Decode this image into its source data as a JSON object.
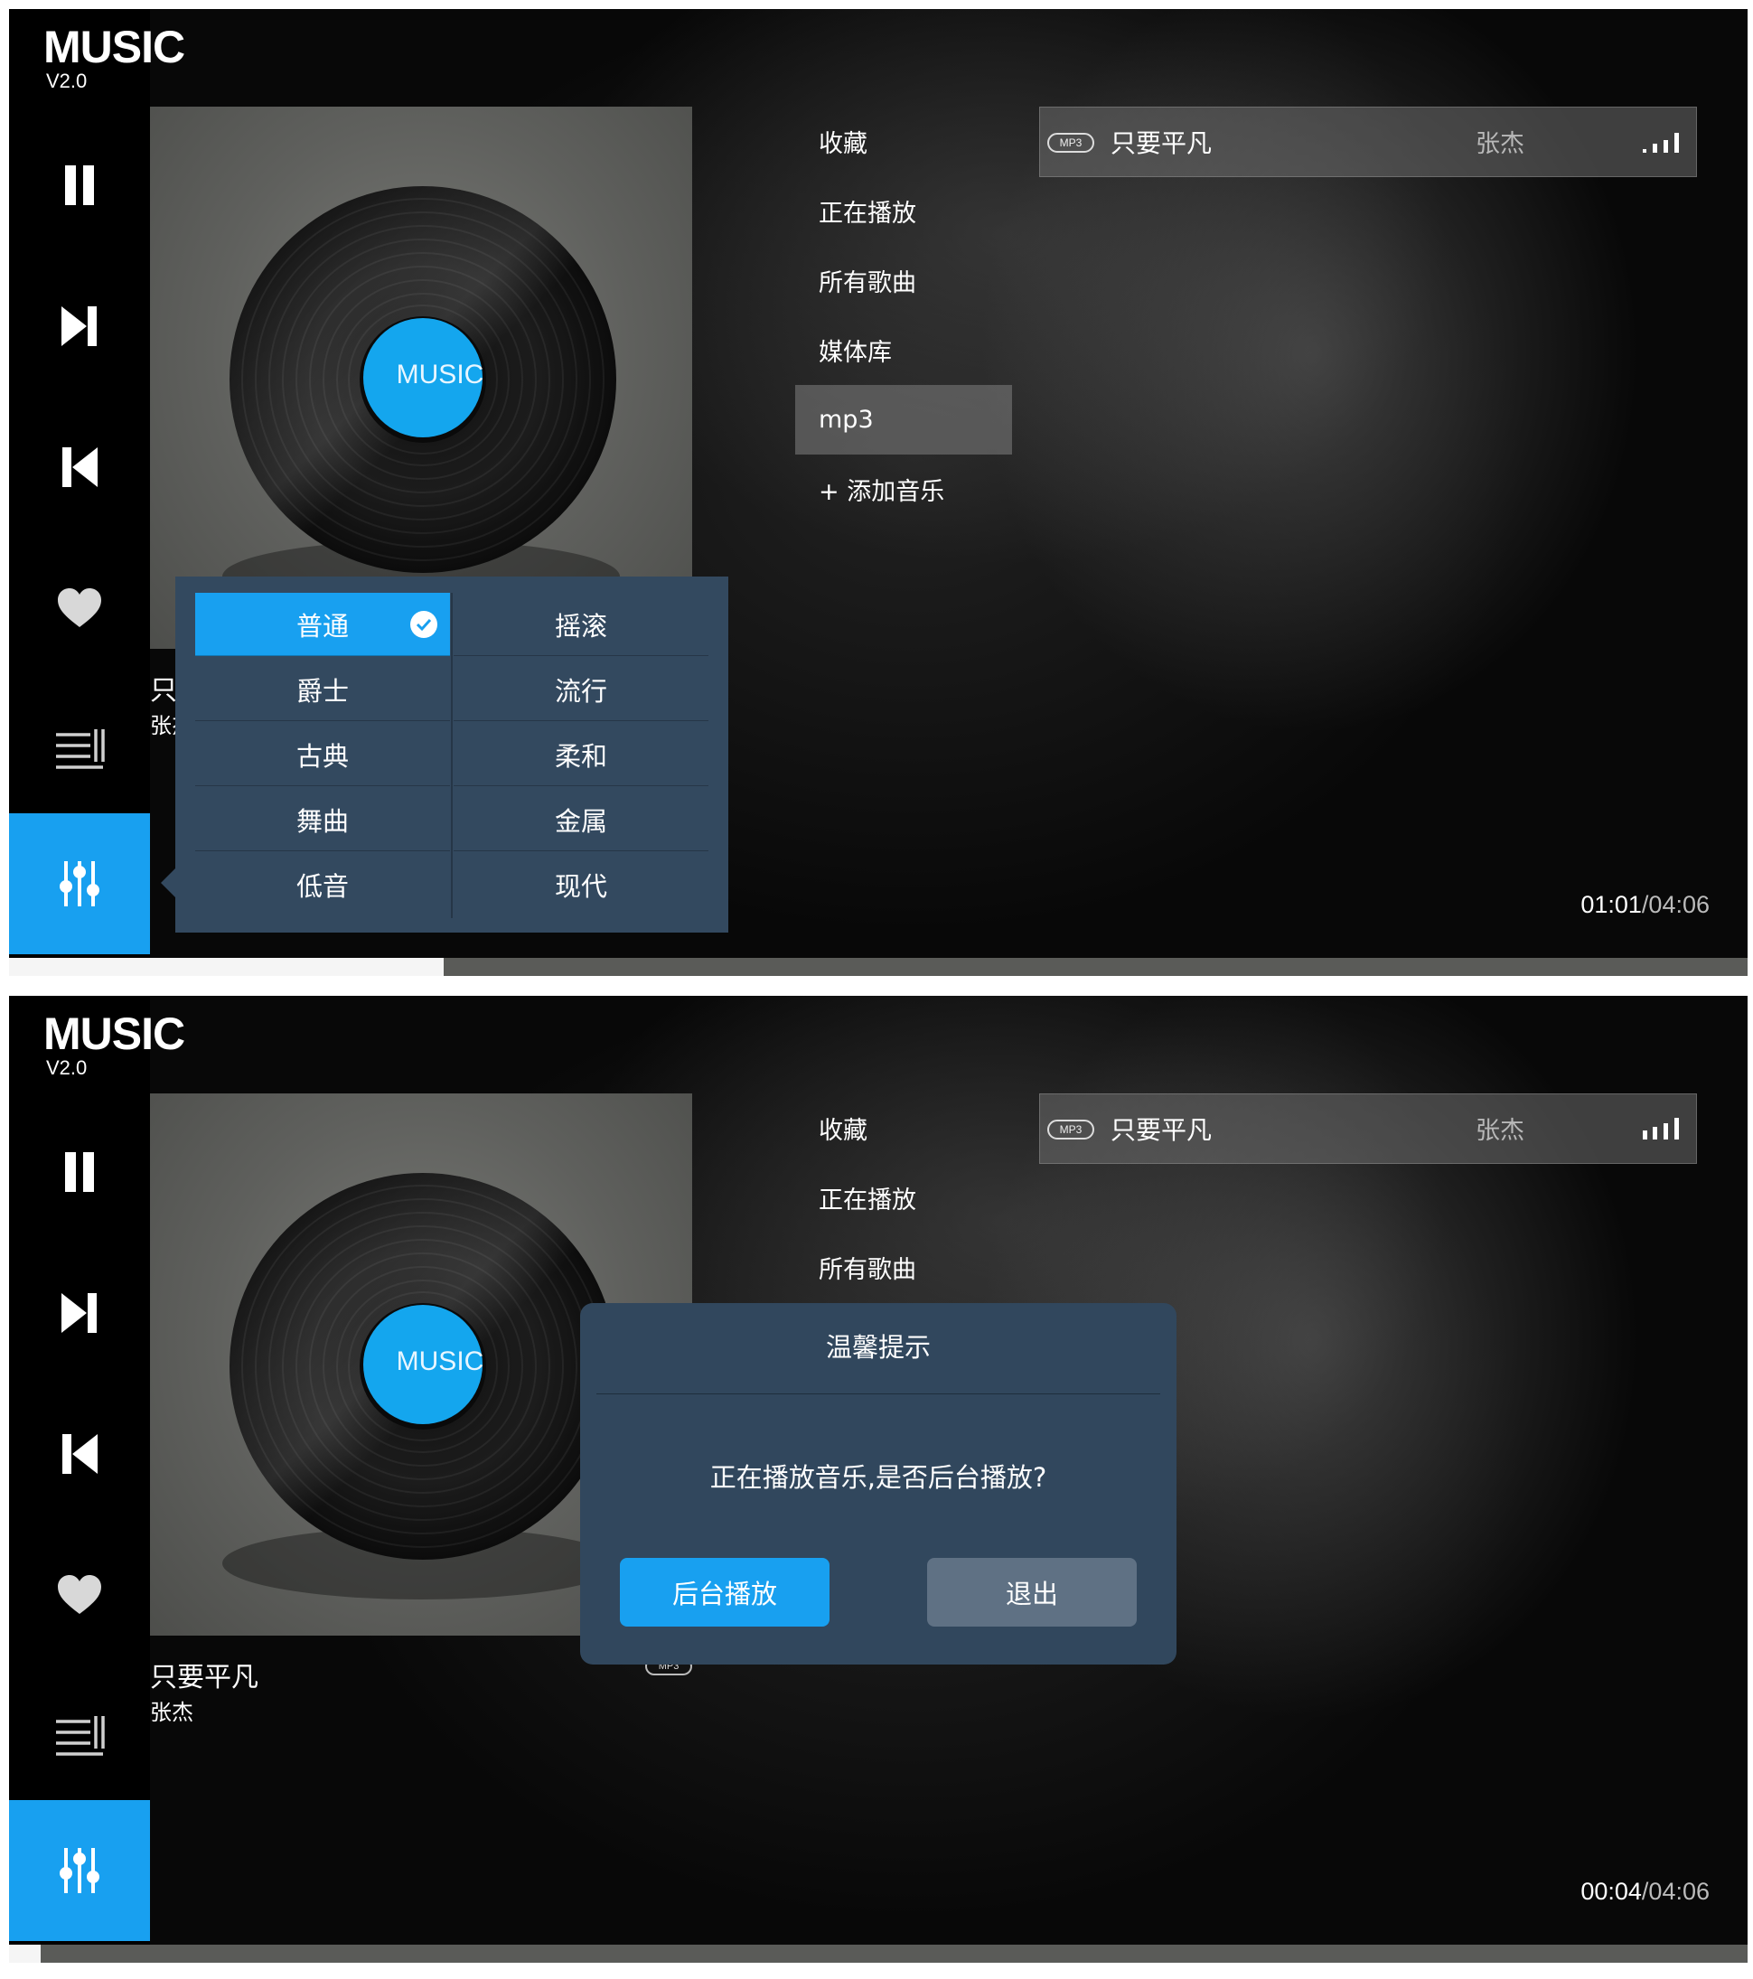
{
  "app": {
    "title": "MUSIC",
    "version": "V2.0"
  },
  "menu": [
    {
      "label": "收藏"
    },
    {
      "label": "正在播放"
    },
    {
      "label": "所有歌曲"
    },
    {
      "label": "媒体库"
    },
    {
      "label": "mp3"
    },
    {
      "label": "+ 添加音乐"
    }
  ],
  "album_label": "MUSIC",
  "track": {
    "badge": "MP3",
    "title": "只要平凡",
    "artist": "张杰"
  },
  "now_playing": {
    "title": "只要平凡",
    "artist": "张杰",
    "badge": "MP3"
  },
  "screen1": {
    "time_current": "01:01",
    "time_total": "04:06",
    "progress": 0.25,
    "selected_menu": "mp3",
    "eq_presets": [
      {
        "label": "普通",
        "selected": true
      },
      {
        "label": "摇滚",
        "selected": false
      },
      {
        "label": "爵士",
        "selected": false
      },
      {
        "label": "流行",
        "selected": false
      },
      {
        "label": "古典",
        "selected": false
      },
      {
        "label": "柔和",
        "selected": false
      },
      {
        "label": "舞曲",
        "selected": false
      },
      {
        "label": "金属",
        "selected": false
      },
      {
        "label": "低音",
        "selected": false
      },
      {
        "label": "现代",
        "selected": false
      }
    ]
  },
  "screen2": {
    "time_current": "00:04",
    "time_total": "04:06",
    "progress": 0.018,
    "dialog": {
      "title": "温馨提示",
      "message": "正在播放音乐,是否后台播放?",
      "primary_button": "后台播放",
      "secondary_button": "退出"
    }
  },
  "colors": {
    "accent": "#18a0f0",
    "popup": "#33495f",
    "dialog": "#31475d"
  },
  "icons": [
    "pause-icon",
    "next-icon",
    "previous-icon",
    "heart-icon",
    "playlist-icon",
    "equalizer-icon",
    "checkmark-icon",
    "signal-bars-icon"
  ]
}
